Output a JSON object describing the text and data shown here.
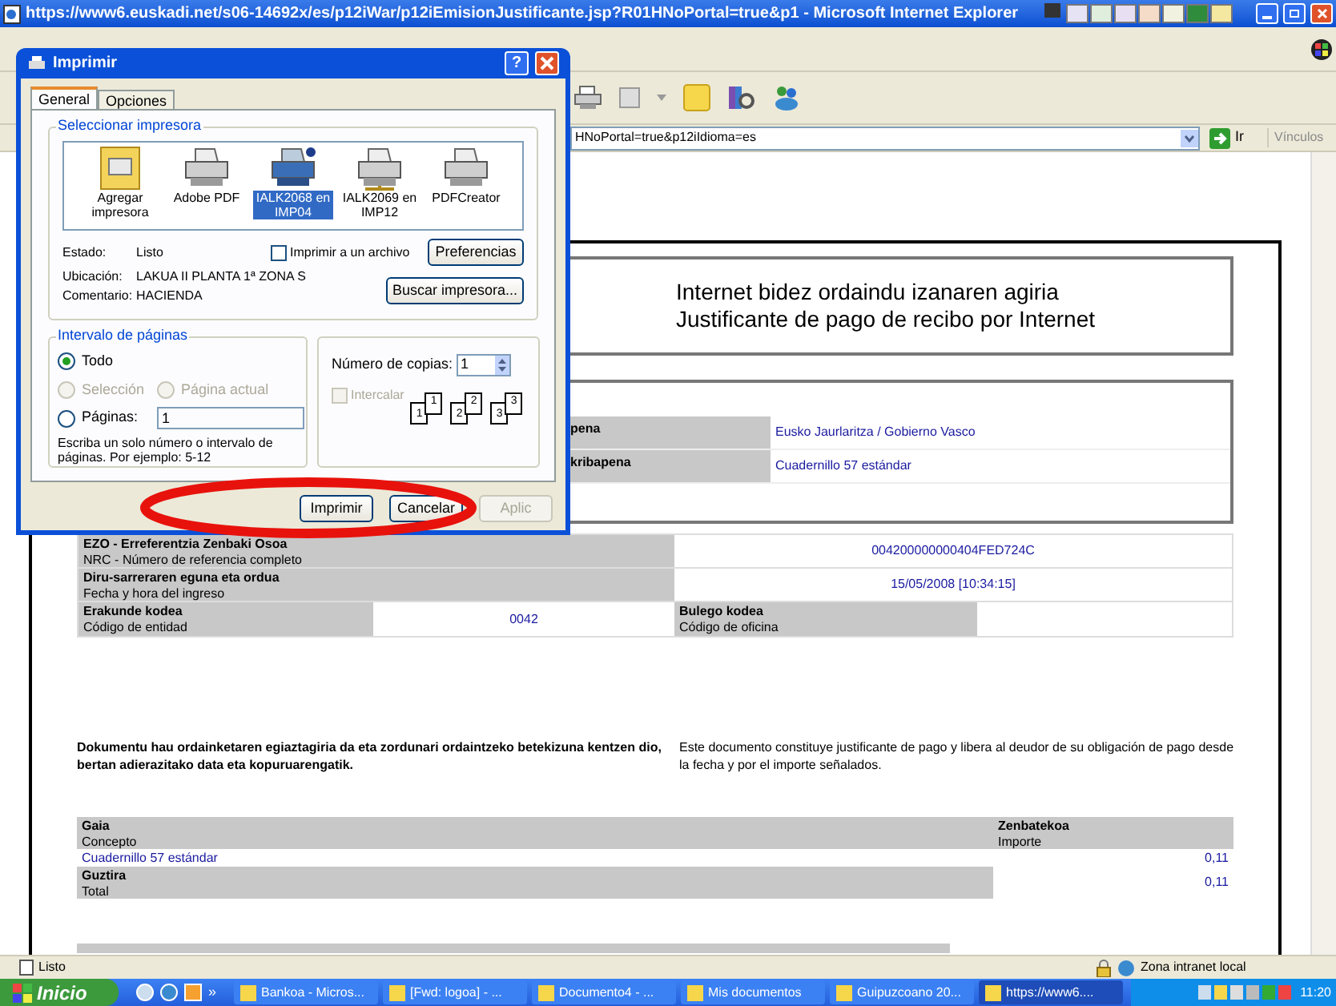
{
  "browser": {
    "title": "https://www6.euskadi.net/s06-14692x/es/p12iWar/p12iEmisionJustificante.jsp?R01HNoPortal=true&p1 - Microsoft Internet Explorer",
    "address": "HNoPortal=true&p12iIdioma=es",
    "go_label": "Ir",
    "links_label": "Vínculos"
  },
  "document": {
    "title": "Internet bidez ordaindu izanaren agiria",
    "subtitle": "Justificante de pago de recibo por Internet",
    "summary_rows": [
      {
        "label": "pena",
        "value": "Eusko Jaurlaritza / Gobierno Vasco"
      },
      {
        "label": "kribapena",
        "value": "Cuadernillo 57 estándar"
      }
    ],
    "reference_rows": [
      {
        "label": "EZO - Erreferentzia Zenbaki Osoa",
        "sublabel": "NRC - Número de referencia completo",
        "value": "004200000000404FED724C"
      },
      {
        "label": "Diru-sarreraren eguna eta ordua",
        "sublabel": "Fecha y hora del ingreso",
        "value": "15/05/2008 [10:34:15]"
      }
    ],
    "codes": [
      {
        "label": "Erakunde kodea",
        "sublabel": "Código de entidad",
        "value": "0042"
      },
      {
        "label": "Bulego kodea",
        "sublabel": "Código de oficina"
      }
    ],
    "notice_eu": "Dokumentu hau ordainketaren egiaztagiria da eta zordunari ordaintzeko betekizuna kentzen dio, bertan adierazitako data eta kopuruarengatik.",
    "notice_es": "Este documento constituye justificante de pago y libera al deudor de su obligación de pago desde la fecha y por el importe señalados.",
    "amounts": {
      "columns": [
        {
          "label": "Gaia",
          "sublabel": "Concepto"
        },
        {
          "label": "Zenbatekoa",
          "sublabel": "Importe"
        }
      ],
      "rows": [
        {
          "kind": "item",
          "label": "Cuadernillo 57 estándar",
          "amount": "0,11"
        },
        {
          "kind": "total",
          "label": "Guztira",
          "sublabel": "Total",
          "amount": "0,11"
        }
      ]
    }
  },
  "dialog": {
    "title": "Imprimir",
    "help": "?",
    "tabs": [
      {
        "label": "General",
        "selected": true
      },
      {
        "label": "Opciones",
        "selected": false
      }
    ],
    "printer_group": "Seleccionar impresora",
    "printers": [
      {
        "kind": "add",
        "label": "Agregar impresora",
        "selected": false
      },
      {
        "kind": "printer",
        "label": "Adobe PDF",
        "selected": false
      },
      {
        "kind": "printer",
        "label": "IALK2068 en IMP04",
        "selected": true
      },
      {
        "kind": "network",
        "label": "IALK2069 en IMP12",
        "selected": false
      },
      {
        "kind": "printer",
        "label": "PDFCreator",
        "selected": false
      }
    ],
    "info": [
      {
        "label": "Estado:",
        "value": "Listo"
      },
      {
        "label": "Ubicación:",
        "value": "LAKUA II PLANTA 1ª ZONA S"
      },
      {
        "label": "Comentario:",
        "value": "HACIENDA"
      }
    ],
    "print_to_file": {
      "label": "Imprimir a un archivo",
      "checked": false
    },
    "preferences": "Preferencias",
    "find_printer": "Buscar impresora...",
    "range_group": "Intervalo de páginas",
    "ranges": [
      {
        "label": "Todo",
        "selected": true,
        "disabled": false
      },
      {
        "label": "Selección",
        "selected": false,
        "disabled": true
      },
      {
        "label": "Página actual",
        "selected": false,
        "disabled": true
      },
      {
        "label": "Páginas:",
        "selected": false,
        "disabled": false
      }
    ],
    "pages_value": "1",
    "range_hint": "Escriba un solo número o intervalo de páginas. Por ejemplo: 5-12",
    "copies_label": "Número de copias:",
    "copies_value": "1",
    "collate": {
      "label": "Intercalar",
      "checked": false,
      "disabled": true
    },
    "collate_pages": [
      "1",
      "1",
      "2",
      "2",
      "3",
      "3"
    ],
    "buttons": [
      {
        "label": "Imprimir",
        "disabled": false
      },
      {
        "label": "Cancelar",
        "disabled": false
      },
      {
        "label": "Aplic",
        "disabled": true
      }
    ]
  },
  "status_bar": {
    "text": "Listo",
    "zone": "Zona intranet local"
  },
  "taskbar": {
    "start": "Inicio",
    "more": "»",
    "tasks": [
      {
        "label": "Bankoa - Micros...",
        "selected": false
      },
      {
        "label": "[Fwd: logoa] - ...",
        "selected": false
      },
      {
        "label": "Documento4 - ...",
        "selected": false
      },
      {
        "label": "Mis documentos",
        "selected": false
      },
      {
        "label": "Guipuzcoano 20...",
        "selected": false
      },
      {
        "label": "https://www6....",
        "selected": true
      }
    ],
    "clock": "11:20"
  }
}
